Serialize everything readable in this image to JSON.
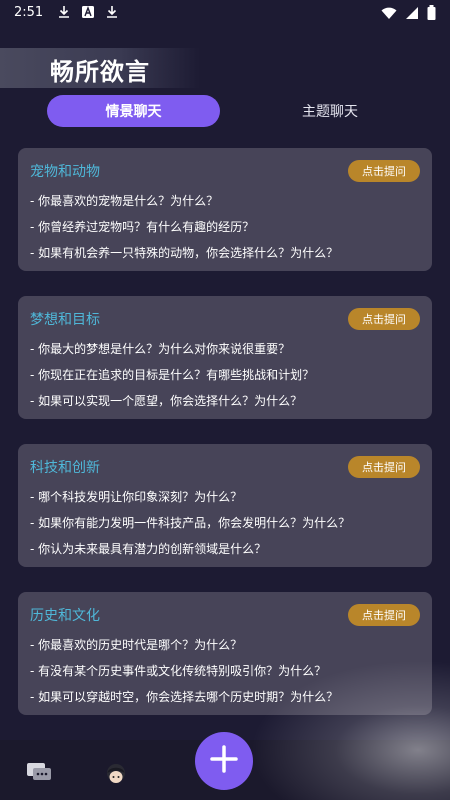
{
  "status_bar": {
    "time": "2:51",
    "icons": [
      "download-icon",
      "font-icon",
      "download-icon",
      "wifi-icon",
      "signal-icon",
      "battery-icon"
    ]
  },
  "app": {
    "title": "畅所欲言"
  },
  "tabs": [
    {
      "label": "情景聊天",
      "active": true
    },
    {
      "label": "主题聊天",
      "active": false
    }
  ],
  "cards": [
    {
      "title": "宠物和动物",
      "button": "点击提问",
      "questions": [
        "- 你最喜欢的宠物是什么？为什么？",
        "- 你曾经养过宠物吗？有什么有趣的经历？",
        "- 如果有机会养一只特殊的动物，你会选择什么？为什么？"
      ]
    },
    {
      "title": "梦想和目标",
      "button": "点击提问",
      "questions": [
        "- 你最大的梦想是什么？为什么对你来说很重要？",
        "- 你现在正在追求的目标是什么？有哪些挑战和计划？",
        "- 如果可以实现一个愿望，你会选择什么？为什么？"
      ]
    },
    {
      "title": "科技和创新",
      "button": "点击提问",
      "questions": [
        "- 哪个科技发明让你印象深刻？为什么？",
        "- 如果你有能力发明一件科技产品，你会发明什么？为什么？",
        "- 你认为未来最具有潜力的创新领域是什么？"
      ]
    },
    {
      "title": "历史和文化",
      "button": "点击提问",
      "questions": [
        "- 你最喜欢的历史时代是哪个？为什么？",
        "- 有没有某个历史事件或文化传统特别吸引你？为什么？",
        "- 如果可以穿越时空，你会选择去哪个历史时期？为什么？"
      ]
    }
  ],
  "bottom_nav": {
    "items": [
      "chat-icon",
      "avatar-icon"
    ],
    "fab": "plus-icon"
  },
  "colors": {
    "background": "#1d1b33",
    "accent": "#7f5cf0",
    "card": "#474458",
    "card_title": "#4fb7d8",
    "ask_button": "#b9862a"
  }
}
